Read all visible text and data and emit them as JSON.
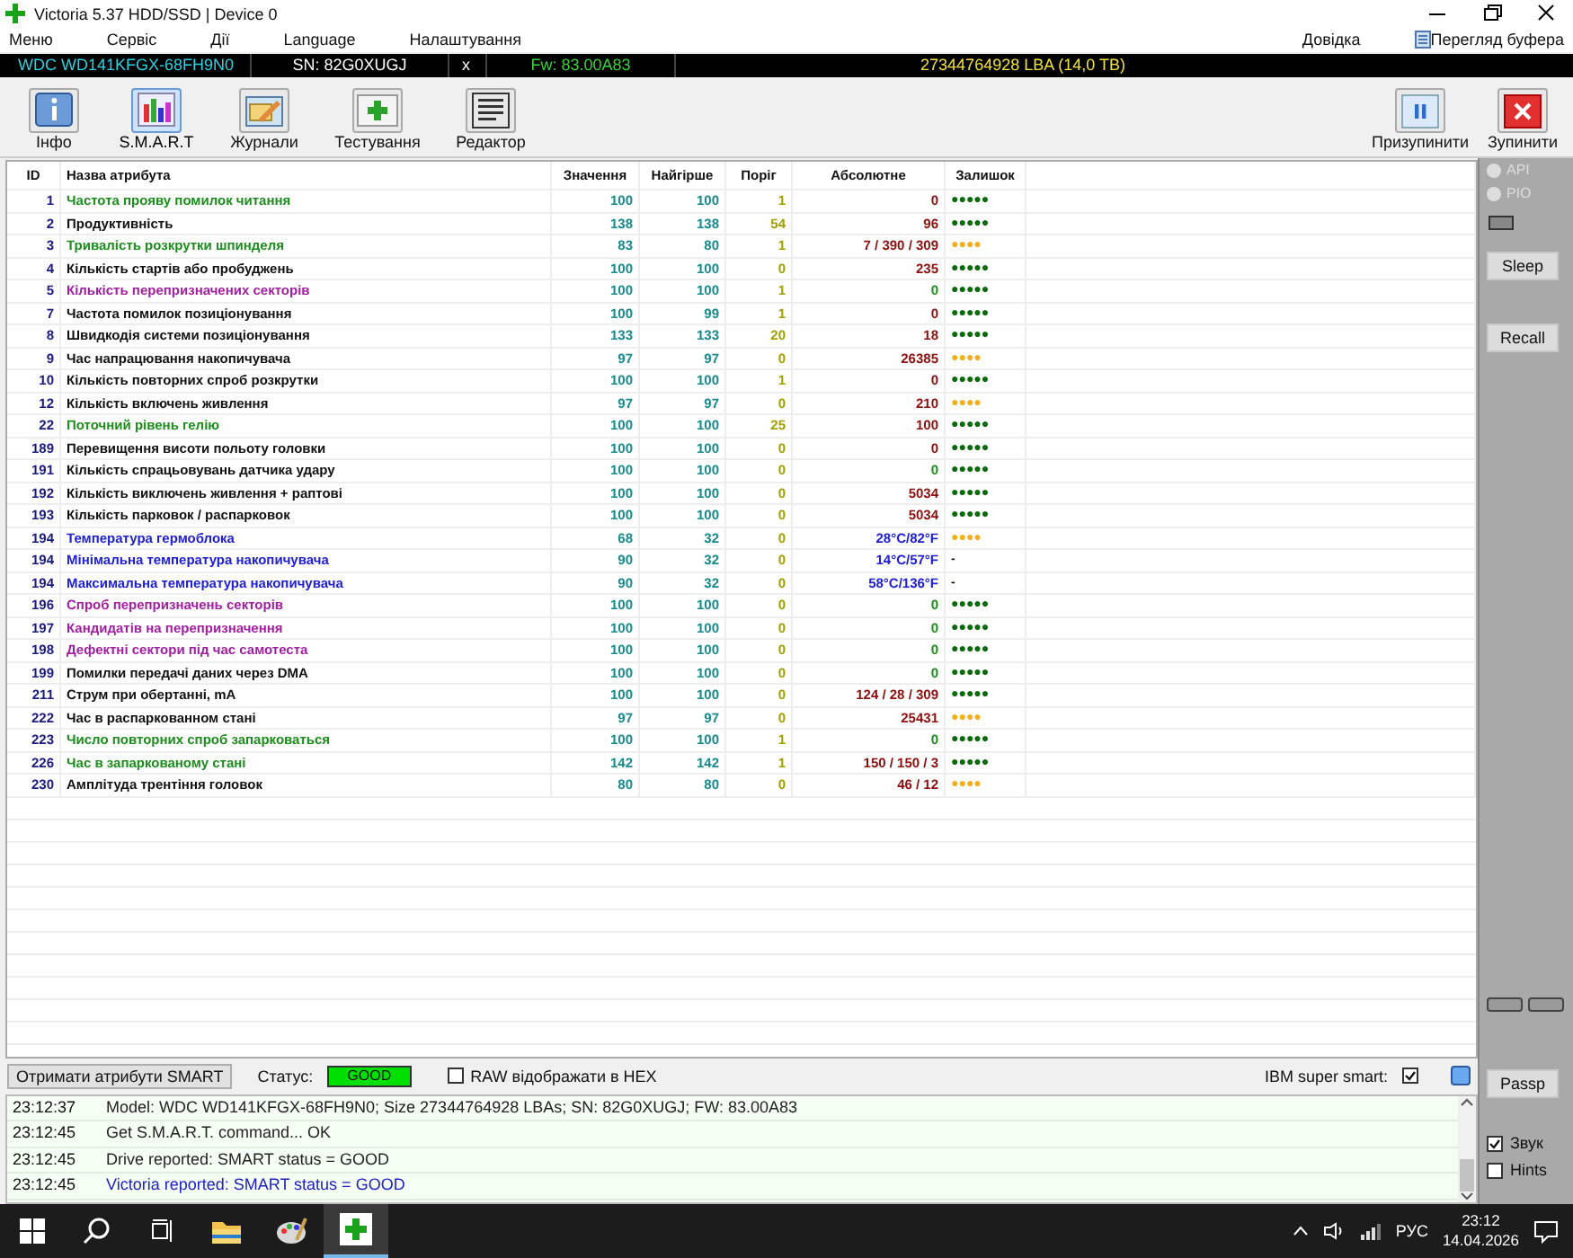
{
  "window": {
    "title": "Victoria 5.37 HDD/SSD | Device 0"
  },
  "menu": {
    "left": [
      "Меню",
      "Сервіс",
      "Дії",
      "Language",
      "Налаштування"
    ],
    "right": [
      "Довідка"
    ],
    "buffer": "Перегляд буфера"
  },
  "drive_bar": {
    "model": "WDC WD141KFGX-68FH9N0",
    "serial": "SN: 82G0XUGJ",
    "close": "x",
    "firmware": "Fw: 83.00A83",
    "capacity": "27344764928 LBA (14,0 TB)"
  },
  "toolbar": {
    "tabs": [
      {
        "label": "Інфо",
        "kind": "info",
        "selected": false
      },
      {
        "label": "S.M.A.R.T",
        "kind": "smart",
        "selected": true
      },
      {
        "label": "Журнали",
        "kind": "logs",
        "selected": false
      },
      {
        "label": "Тестування",
        "kind": "test",
        "selected": false
      },
      {
        "label": "Редактор",
        "kind": "editor",
        "selected": false
      }
    ],
    "actions": [
      {
        "label": "Призупинити",
        "kind": "pause"
      },
      {
        "label": "Зупинити",
        "kind": "stop"
      }
    ]
  },
  "table": {
    "columns": [
      "ID",
      "Назва атрибута",
      "Значення",
      "Найгірше",
      "Поріг",
      "Абсолютне",
      "Залишок"
    ],
    "rows": [
      {
        "id": "1",
        "name": "Частота прояву помилок читання",
        "color": "#1e8c1e",
        "value": "100",
        "worst": "100",
        "threshold": "1",
        "absolute": {
          "text": "0",
          "color": "#8b1010"
        },
        "remaining": {
          "text": "●●●●●",
          "color": "#0a6a0a"
        }
      },
      {
        "id": "2",
        "name": "Продуктивність",
        "color": "#111111",
        "value": "138",
        "worst": "138",
        "threshold": "54",
        "absolute": {
          "text": "96",
          "color": "#8b1010"
        },
        "remaining": {
          "text": "●●●●●",
          "color": "#0a6a0a"
        }
      },
      {
        "id": "3",
        "name": "Тривалість розкрутки шпинделя",
        "color": "#1e8c1e",
        "value": "83",
        "worst": "80",
        "threshold": "1",
        "absolute": {
          "text": "7 / 390 / 309",
          "color": "#8b1010"
        },
        "remaining": {
          "text": "●●●●",
          "color": "#f0b020"
        }
      },
      {
        "id": "4",
        "name": "Кількість стартів або пробуджень",
        "color": "#111111",
        "value": "100",
        "worst": "100",
        "threshold": "0",
        "absolute": {
          "text": "235",
          "color": "#8b1010"
        },
        "remaining": {
          "text": "●●●●●",
          "color": "#0a6a0a"
        }
      },
      {
        "id": "5",
        "name": "Кількість перепризначених секторів",
        "color": "#a020a0",
        "value": "100",
        "worst": "100",
        "threshold": "1",
        "absolute": {
          "text": "0",
          "color": "#1e8c1e"
        },
        "remaining": {
          "text": "●●●●●",
          "color": "#0a6a0a"
        }
      },
      {
        "id": "7",
        "name": "Частота помилок позиціонування",
        "color": "#111111",
        "value": "100",
        "worst": "99",
        "threshold": "1",
        "absolute": {
          "text": "0",
          "color": "#8b1010"
        },
        "remaining": {
          "text": "●●●●●",
          "color": "#0a6a0a"
        }
      },
      {
        "id": "8",
        "name": "Швидкодія системи позиціонування",
        "color": "#111111",
        "value": "133",
        "worst": "133",
        "threshold": "20",
        "absolute": {
          "text": "18",
          "color": "#8b1010"
        },
        "remaining": {
          "text": "●●●●●",
          "color": "#0a6a0a"
        }
      },
      {
        "id": "9",
        "name": "Час напрацювання накопичувача",
        "color": "#111111",
        "value": "97",
        "worst": "97",
        "threshold": "0",
        "absolute": {
          "text": "26385",
          "color": "#8b1010"
        },
        "remaining": {
          "text": "●●●●",
          "color": "#f0b020"
        }
      },
      {
        "id": "10",
        "name": "Кількість повторних спроб розкрутки",
        "color": "#111111",
        "value": "100",
        "worst": "100",
        "threshold": "1",
        "absolute": {
          "text": "0",
          "color": "#8b1010"
        },
        "remaining": {
          "text": "●●●●●",
          "color": "#0a6a0a"
        }
      },
      {
        "id": "12",
        "name": "Кількість включень живлення",
        "color": "#111111",
        "value": "97",
        "worst": "97",
        "threshold": "0",
        "absolute": {
          "text": "210",
          "color": "#8b1010"
        },
        "remaining": {
          "text": "●●●●",
          "color": "#f0b020"
        }
      },
      {
        "id": "22",
        "name": "Поточний рівень гелію",
        "color": "#1e8c1e",
        "value": "100",
        "worst": "100",
        "threshold": "25",
        "absolute": {
          "text": "100",
          "color": "#8b1010"
        },
        "remaining": {
          "text": "●●●●●",
          "color": "#0a6a0a"
        }
      },
      {
        "id": "189",
        "name": "Перевищення висоти польоту головки",
        "color": "#111111",
        "value": "100",
        "worst": "100",
        "threshold": "0",
        "absolute": {
          "text": "0",
          "color": "#8b1010"
        },
        "remaining": {
          "text": "●●●●●",
          "color": "#0a6a0a"
        }
      },
      {
        "id": "191",
        "name": "Кількість спрацьовувань датчика удару",
        "color": "#111111",
        "value": "100",
        "worst": "100",
        "threshold": "0",
        "absolute": {
          "text": "0",
          "color": "#1e8c1e"
        },
        "remaining": {
          "text": "●●●●●",
          "color": "#0a6a0a"
        }
      },
      {
        "id": "192",
        "name": "Кількість виключень живлення + раптові",
        "color": "#111111",
        "value": "100",
        "worst": "100",
        "threshold": "0",
        "absolute": {
          "text": "5034",
          "color": "#8b1010"
        },
        "remaining": {
          "text": "●●●●●",
          "color": "#0a6a0a"
        }
      },
      {
        "id": "193",
        "name": "Кількість парковок / распарковок",
        "color": "#111111",
        "value": "100",
        "worst": "100",
        "threshold": "0",
        "absolute": {
          "text": "5034",
          "color": "#8b1010"
        },
        "remaining": {
          "text": "●●●●●",
          "color": "#0a6a0a"
        }
      },
      {
        "id": "194",
        "name": "Температура гермоблока",
        "color": "#2020d0",
        "value": "68",
        "worst": "32",
        "threshold": "0",
        "absolute": {
          "text": "28°C/82°F",
          "color": "#2020d0"
        },
        "remaining": {
          "text": "●●●●",
          "color": "#f0b020"
        }
      },
      {
        "id": "194",
        "name": "Мінімальна температура накопичувача",
        "color": "#2020d0",
        "value": "90",
        "worst": "32",
        "threshold": "0",
        "absolute": {
          "text": "14°C/57°F",
          "color": "#2020d0"
        },
        "remaining": {
          "text": "-",
          "color": "#111111"
        }
      },
      {
        "id": "194",
        "name": "Максимальна температура накопичувача",
        "color": "#2020d0",
        "value": "90",
        "worst": "32",
        "threshold": "0",
        "absolute": {
          "text": "58°C/136°F",
          "color": "#2020d0"
        },
        "remaining": {
          "text": "-",
          "color": "#111111"
        }
      },
      {
        "id": "196",
        "name": "Спроб перепризначень секторів",
        "color": "#a020a0",
        "value": "100",
        "worst": "100",
        "threshold": "0",
        "absolute": {
          "text": "0",
          "color": "#1e8c1e"
        },
        "remaining": {
          "text": "●●●●●",
          "color": "#0a6a0a"
        }
      },
      {
        "id": "197",
        "name": "Кандидатів на перепризначення",
        "color": "#a020a0",
        "value": "100",
        "worst": "100",
        "threshold": "0",
        "absolute": {
          "text": "0",
          "color": "#1e8c1e"
        },
        "remaining": {
          "text": "●●●●●",
          "color": "#0a6a0a"
        }
      },
      {
        "id": "198",
        "name": "Дефектні сектори під час самотеста",
        "color": "#a020a0",
        "value": "100",
        "worst": "100",
        "threshold": "0",
        "absolute": {
          "text": "0",
          "color": "#1e8c1e"
        },
        "remaining": {
          "text": "●●●●●",
          "color": "#0a6a0a"
        }
      },
      {
        "id": "199",
        "name": "Помилки передачі даних через DMA",
        "color": "#111111",
        "value": "100",
        "worst": "100",
        "threshold": "0",
        "absolute": {
          "text": "0",
          "color": "#1e8c1e"
        },
        "remaining": {
          "text": "●●●●●",
          "color": "#0a6a0a"
        }
      },
      {
        "id": "211",
        "name": "Струм при обертанні, mA",
        "color": "#111111",
        "value": "100",
        "worst": "100",
        "threshold": "0",
        "absolute": {
          "text": "124 / 28 / 309",
          "color": "#8b1010"
        },
        "remaining": {
          "text": "●●●●●",
          "color": "#0a6a0a"
        }
      },
      {
        "id": "222",
        "name": "Час в распаркованном стані",
        "color": "#111111",
        "value": "97",
        "worst": "97",
        "threshold": "0",
        "absolute": {
          "text": "25431",
          "color": "#8b1010"
        },
        "remaining": {
          "text": "●●●●",
          "color": "#f0b020"
        }
      },
      {
        "id": "223",
        "name": "Число повторних спроб запарковаться",
        "color": "#1e8c1e",
        "value": "100",
        "worst": "100",
        "threshold": "1",
        "absolute": {
          "text": "0",
          "color": "#1e8c1e"
        },
        "remaining": {
          "text": "●●●●●",
          "color": "#0a6a0a"
        }
      },
      {
        "id": "226",
        "name": "Час в запаркованому стані",
        "color": "#1e8c1e",
        "value": "142",
        "worst": "142",
        "threshold": "1",
        "absolute": {
          "text": "150 / 150 / 3",
          "color": "#8b1010"
        },
        "remaining": {
          "text": "●●●●●",
          "color": "#0a6a0a"
        }
      },
      {
        "id": "230",
        "name": "Амплітуда трентіння головок",
        "color": "#111111",
        "value": "80",
        "worst": "80",
        "threshold": "0",
        "absolute": {
          "text": "46 / 12",
          "color": "#8b1010"
        },
        "remaining": {
          "text": "●●●●",
          "color": "#f0b020"
        }
      }
    ]
  },
  "bottom_bar": {
    "get_button": "Отримати атрибути SMART",
    "status_label": "Статус:",
    "status": {
      "text": "GOOD",
      "color": "#00e000"
    },
    "raw_hex": {
      "label": "RAW відображати в HEX",
      "checked": false
    },
    "ibm_label": "IBM super smart:",
    "ibm_checked": true
  },
  "side_panel": {
    "modes": [
      {
        "label": "API",
        "selected": false,
        "disabled": true
      },
      {
        "label": "PIO",
        "selected": false,
        "disabled": true
      }
    ],
    "buttons": [
      "Sleep",
      "Recall"
    ],
    "bottom_button": "Passp",
    "options": [
      {
        "label": "Звук",
        "checked": true
      },
      {
        "label": "Hints",
        "checked": false
      }
    ]
  },
  "log": [
    {
      "time": "23:12:37",
      "text": "Model: WDC WD141KFGX-68FH9N0; Size 27344764928 LBAs; SN: 82G0XUGJ; FW: 83.00A83",
      "color": "#222222"
    },
    {
      "time": "23:12:45",
      "text": "Get S.M.A.R.T. command... OK",
      "color": "#222222"
    },
    {
      "time": "23:12:45",
      "text": "Drive reported: SMART status = GOOD",
      "color": "#222222"
    },
    {
      "time": "23:12:45",
      "text": "Victoria reported: SMART status = GOOD",
      "color": "#2020c0"
    }
  ],
  "taskbar": {
    "language": "РУС",
    "time": "23:12",
    "date": "14.04.2026"
  }
}
